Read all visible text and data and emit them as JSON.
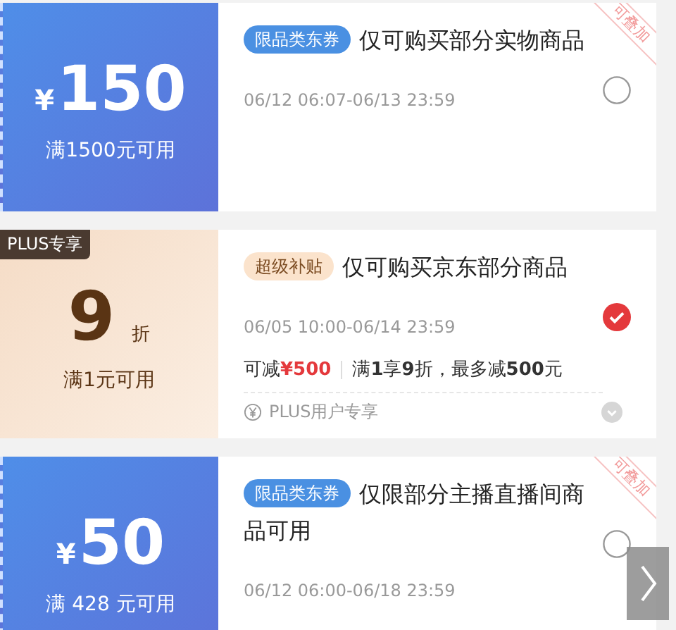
{
  "coupons": [
    {
      "kind": "amount",
      "currency": "¥",
      "value": "150",
      "condition": "满1500元可用",
      "tag": "限品类东券",
      "title": "仅可购买部分实物商品",
      "validity": "06/12 06:07-06/13 23:59",
      "stack_badge": "可叠加",
      "selected": false
    },
    {
      "kind": "discount",
      "corner_badge": "PLUS专享",
      "value": "9",
      "unit": "折",
      "condition": "满1元可用",
      "tag": "超级补贴",
      "title": "仅可购买京东部分商品",
      "validity": "06/05 10:00-06/14 23:59",
      "savings_label": "可减",
      "savings_value": "¥500",
      "rule": "满**1**享**9**折，最多减**500**元",
      "footer": "PLUS用户专享",
      "selected": true
    },
    {
      "kind": "amount",
      "currency": "¥",
      "value": "50",
      "condition": "满 428 元可用",
      "tag": "限品类东券",
      "title": "仅限部分主播直播间商品可用",
      "validity": "06/12 06:00-06/18 23:59",
      "stack_badge": "可叠加",
      "selected": false
    }
  ]
}
